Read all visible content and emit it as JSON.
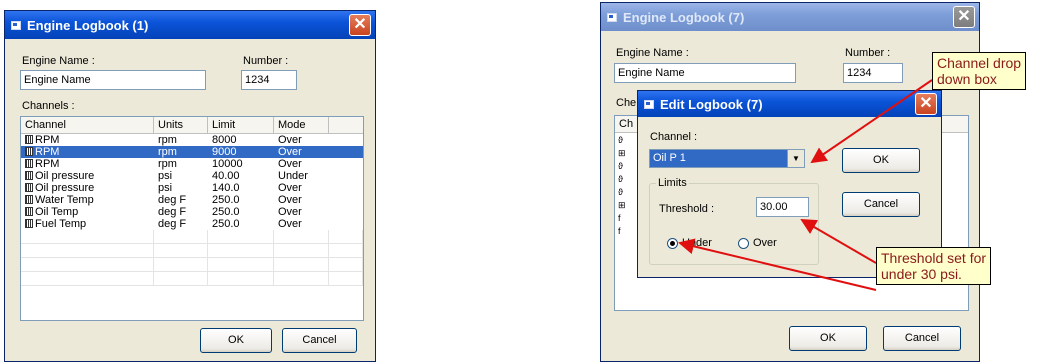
{
  "left_dialog": {
    "title": "Engine Logbook (1)",
    "engine_name_label": "Engine Name :",
    "engine_name_value": "Engine Name",
    "number_label": "Number :",
    "number_value": "1234",
    "channels_label": "Channels :",
    "columns": [
      "Channel",
      "Units",
      "Limit",
      "Mode"
    ],
    "rows": [
      {
        "channel": "RPM",
        "units": "rpm",
        "limit": "8000",
        "mode": "Over",
        "selected": false
      },
      {
        "channel": "RPM",
        "units": "rpm",
        "limit": "9000",
        "mode": "Over",
        "selected": true
      },
      {
        "channel": "RPM",
        "units": "rpm",
        "limit": "10000",
        "mode": "Over",
        "selected": false
      },
      {
        "channel": "Oil pressure",
        "units": "psi",
        "limit": "40.00",
        "mode": "Under",
        "selected": false
      },
      {
        "channel": "Oil pressure",
        "units": "psi",
        "limit": "140.0",
        "mode": "Over",
        "selected": false
      },
      {
        "channel": "Water Temp",
        "units": "deg F",
        "limit": "250.0",
        "mode": "Over",
        "selected": false
      },
      {
        "channel": "Oil Temp",
        "units": "deg F",
        "limit": "250.0",
        "mode": "Over",
        "selected": false
      },
      {
        "channel": "Fuel Temp",
        "units": "deg F",
        "limit": "250.0",
        "mode": "Over",
        "selected": false
      }
    ],
    "ok_label": "OK",
    "cancel_label": "Cancel"
  },
  "right_dialog": {
    "title": "Engine Logbook (7)",
    "engine_name_label": "Engine Name :",
    "engine_name_value": "Engine Name",
    "number_label": "Number :",
    "number_value": "1234",
    "channels_label_partial": "Che",
    "col_partial": "Ch",
    "ok_label": "OK",
    "cancel_label": "Cancel"
  },
  "edit_dialog": {
    "title": "Edit Logbook (7)",
    "channel_label": "Channel :",
    "channel_value": "Oil P 1",
    "limits_label": "Limits",
    "threshold_label": "Threshold :",
    "threshold_value": "30.00",
    "under_label": "Under",
    "over_label": "Over",
    "mode_selected": "under",
    "ok_label": "OK",
    "cancel_label": "Cancel"
  },
  "callouts": {
    "channel": [
      "Channel drop",
      "down box"
    ],
    "threshold": [
      "Threshold set for",
      "under 30 psi."
    ]
  },
  "colors": {
    "annotation_arrow": "#e01010",
    "selection": "#316ac5"
  }
}
